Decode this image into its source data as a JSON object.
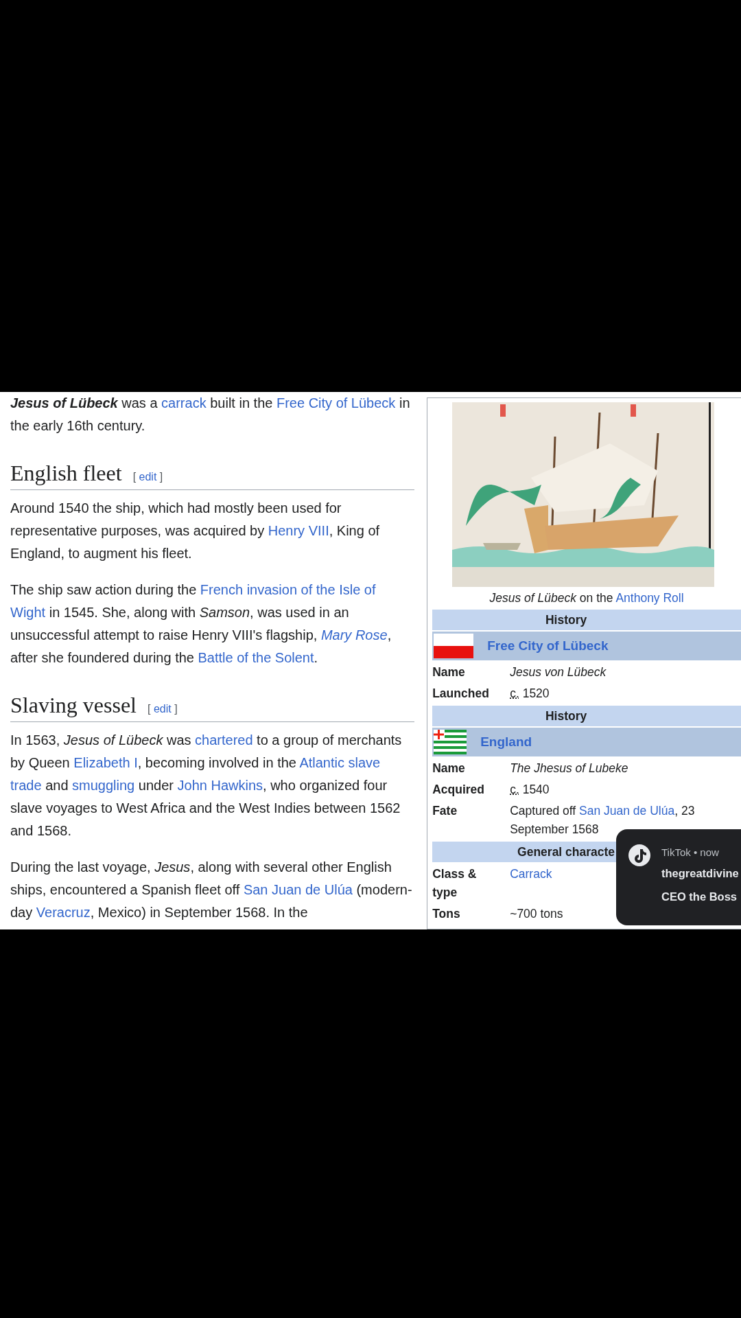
{
  "article": {
    "intro": [
      {
        "text": "Jesus of Lübeck",
        "kind": "bold-italic"
      },
      {
        "text": " was a ",
        "kind": "plain"
      },
      {
        "text": "carrack",
        "kind": "link"
      },
      {
        "text": " built in the ",
        "kind": "plain"
      },
      {
        "text": "Free City of Lübeck",
        "kind": "link"
      },
      {
        "text": " in the early 16th century.",
        "kind": "plain"
      }
    ],
    "sections": [
      {
        "heading": "English fleet",
        "edit": {
          "before": "[",
          "link": "edit",
          "after": "]"
        },
        "paragraphs": [
          [
            {
              "text": "Around 1540 the ship, which had mostly been used for representative purposes, was acquired by ",
              "kind": "plain"
            },
            {
              "text": "Henry VIII",
              "kind": "link"
            },
            {
              "text": ", King of England, to augment his fleet.",
              "kind": "plain"
            }
          ],
          [
            {
              "text": "The ship saw action during the ",
              "kind": "plain"
            },
            {
              "text": "French invasion of the Isle of",
              "kind": "link"
            },
            {
              "text": "Wight",
              "kind": "link"
            },
            {
              "text": " in 1545. She, along with ",
              "kind": "plain"
            },
            {
              "text": "Samson",
              "kind": "italic"
            },
            {
              "text": ", was used in an unsuccessful attempt to raise Henry VIII's flagship, ",
              "kind": "plain"
            },
            {
              "text": "Mary Rose",
              "kind": "italic-link"
            },
            {
              "text": ", after she foundered during the ",
              "kind": "plain"
            },
            {
              "text": "Battle of the Solent",
              "kind": "link"
            },
            {
              "text": ".",
              "kind": "plain"
            }
          ]
        ]
      },
      {
        "heading": "Slaving vessel",
        "edit": {
          "before": "[",
          "link": "edit",
          "after": "]"
        },
        "paragraphs": [
          [
            {
              "text": "In 1563, ",
              "kind": "plain"
            },
            {
              "text": "Jesus of Lübeck",
              "kind": "italic"
            },
            {
              "text": " was ",
              "kind": "plain"
            },
            {
              "text": "chartered",
              "kind": "link"
            },
            {
              "text": " to a group of merchants by Queen ",
              "kind": "plain"
            },
            {
              "text": "Elizabeth I",
              "kind": "link"
            },
            {
              "text": ", becoming involved in the ",
              "kind": "plain"
            },
            {
              "text": "Atlantic slave",
              "kind": "link"
            },
            {
              "text": "trade",
              "kind": "link"
            },
            {
              "text": " and ",
              "kind": "plain"
            },
            {
              "text": "smuggling",
              "kind": "link"
            },
            {
              "text": " under ",
              "kind": "plain"
            },
            {
              "text": "John Hawkins",
              "kind": "link"
            },
            {
              "text": ", who organized four slave voyages to West Africa and the West Indies between 1562 and 1568.",
              "kind": "plain"
            }
          ],
          [
            {
              "text": "During the last voyage, ",
              "kind": "plain"
            },
            {
              "text": "Jesus",
              "kind": "italic"
            },
            {
              "text": ", along with several other English ships, encountered a Spanish fleet off ",
              "kind": "plain"
            },
            {
              "text": "San Juan de Ulúa",
              "kind": "link"
            },
            {
              "text": " (modern-day ",
              "kind": "plain"
            },
            {
              "text": "Veracruz",
              "kind": "link"
            },
            {
              "text": ", Mexico) in September 1568. In the",
              "kind": "plain"
            }
          ]
        ]
      }
    ]
  },
  "infobox": {
    "caption": [
      {
        "text": "Jesus of Lübeck",
        "kind": "italic"
      },
      {
        "text": " on the ",
        "kind": "plain"
      },
      {
        "text": "Anthony Roll",
        "kind": "link"
      }
    ],
    "rows": [
      {
        "kind": "header",
        "text": "History"
      },
      {
        "kind": "flag",
        "text": "Free City of Lübeck"
      },
      {
        "kind": "field",
        "label": "Name",
        "value": [
          {
            "text": "Jesus von Lübeck",
            "kind": "italic"
          }
        ]
      },
      {
        "kind": "field",
        "label": "Launched",
        "value": [
          {
            "text": "c.",
            "kind": "abbr"
          },
          {
            "text": " 1520",
            "kind": "plain"
          }
        ]
      },
      {
        "kind": "header",
        "text": "History"
      },
      {
        "kind": "flag",
        "text": "England"
      },
      {
        "kind": "field",
        "label": "Name",
        "value": [
          {
            "text": "The Jhesus of Lubeke",
            "kind": "italic"
          }
        ]
      },
      {
        "kind": "field",
        "label": "Acquired",
        "value": [
          {
            "text": "c.",
            "kind": "abbr"
          },
          {
            "text": " 1540",
            "kind": "plain"
          }
        ]
      },
      {
        "kind": "field",
        "label": "Fate",
        "value": [
          {
            "text": "Captured off ",
            "kind": "plain"
          },
          {
            "text": "San Juan de Ulúa",
            "kind": "link"
          },
          {
            "text": ", 23 September 1568",
            "kind": "plain"
          }
        ]
      },
      {
        "kind": "header",
        "text": "General characte"
      },
      {
        "kind": "field",
        "label": "Class & type",
        "value": [
          {
            "text": "Carrack",
            "kind": "link"
          }
        ]
      },
      {
        "kind": "field",
        "label": "Tons",
        "value": [
          {
            "text": "~700 tons",
            "kind": "plain"
          }
        ]
      }
    ]
  },
  "notification": {
    "app_line": "TikTok • now",
    "title": "thegreatdivine",
    "body": "CEO the Boss"
  }
}
